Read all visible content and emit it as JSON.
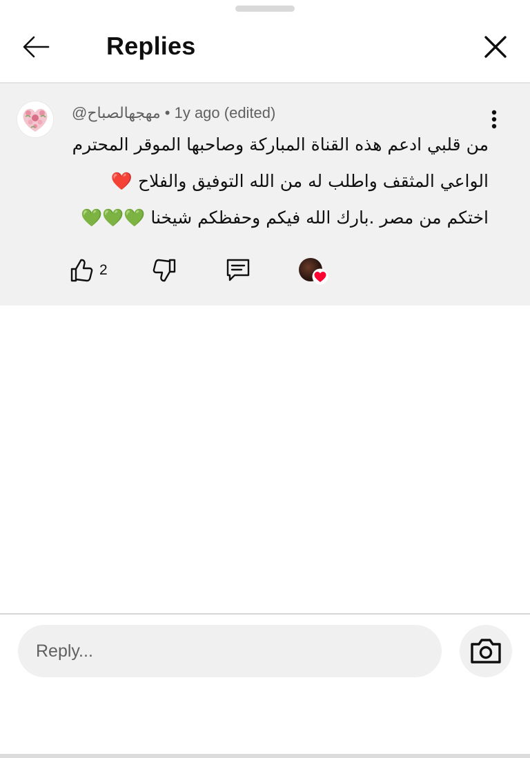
{
  "header": {
    "title": "Replies"
  },
  "comment": {
    "author": "@مهجهالصباح",
    "separator": "•",
    "time": "1y ago (edited)",
    "text": "من قلبي ادعم هذه القناة المباركة وصاحبها الموقر المحترم الواعي المثقف واطلب له من الله التوفيق والفلاح ❤️ اختكم من مصر .بارك الله فيكم وحفظكم شيخنا 💚💚💚",
    "like_count": "2"
  },
  "reply_box": {
    "placeholder": "Reply..."
  },
  "icons": {
    "back": "back-arrow-icon",
    "close": "close-icon",
    "more": "more-vert-icon",
    "like": "thumbs-up-icon",
    "dislike": "thumbs-down-icon",
    "reply": "comment-icon",
    "heart": "creator-heart-icon",
    "camera": "camera-icon"
  },
  "colors": {
    "comment_background": "#f1f1f1",
    "heart_red": "#ff0033",
    "text_secondary": "#606060"
  }
}
